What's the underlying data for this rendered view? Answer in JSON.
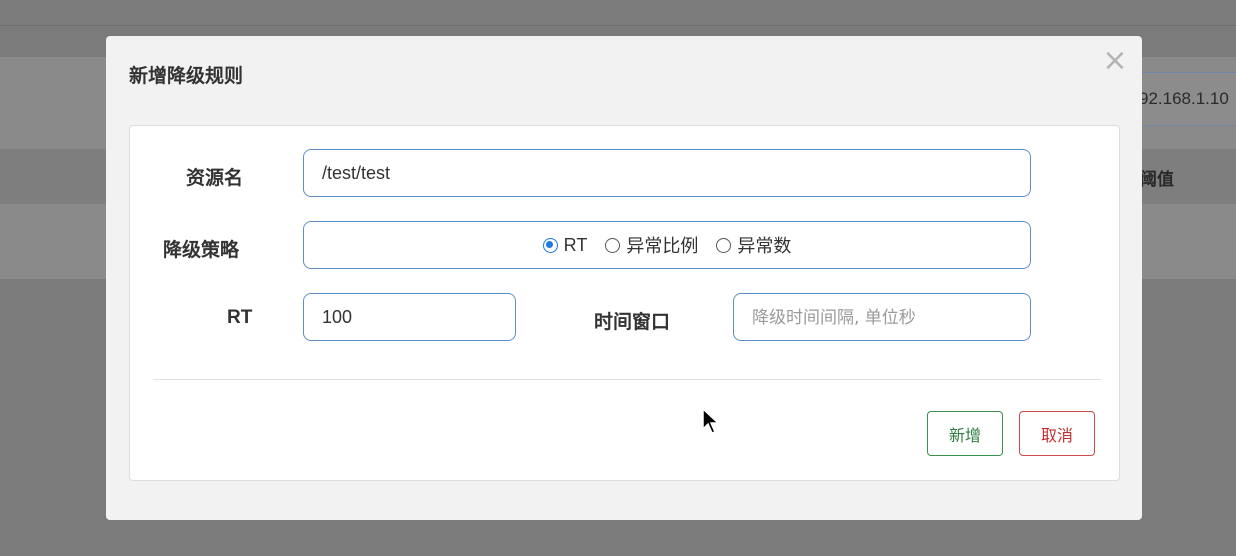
{
  "background": {
    "ip_text": "92.168.1.10",
    "column_header": "阈值"
  },
  "modal": {
    "title": "新增降级规则",
    "close_symbol": "×",
    "resource": {
      "label": "资源名",
      "value": "/test/test"
    },
    "strategy": {
      "label": "降级策略",
      "options": [
        "RT",
        "异常比例",
        "异常数"
      ],
      "selected": "RT"
    },
    "rt": {
      "label": "RT",
      "value": "100"
    },
    "time_window": {
      "label": "时间窗口",
      "placeholder": "降级时间间隔, 单位秒",
      "value": ""
    },
    "buttons": {
      "add": "新增",
      "cancel": "取消"
    }
  },
  "colors": {
    "input_border": "#5e8fc4",
    "radio_checked": "#1f7ae0",
    "add_button": "#2e7d3f",
    "cancel_button": "#c62f2f"
  }
}
